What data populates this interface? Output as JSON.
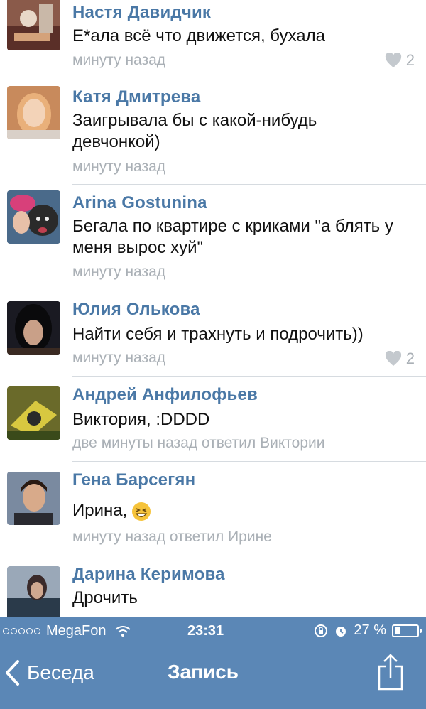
{
  "comments": [
    {
      "author": "Настя Давидчик",
      "text": "Е*ала всё что движется, бухала",
      "meta": "минуту назад",
      "likes": "2"
    },
    {
      "author": "Катя Дмитрева",
      "text": "Заигрывала бы с какой-нибудь девчонкой)",
      "meta": "минуту назад"
    },
    {
      "author": "Arina Gostunina",
      "text": "Бегала по квартире с криками \"а блять у меня вырос хуй\"",
      "meta": "минуту назад"
    },
    {
      "author": "Юлия Олькова",
      "text": "Найти себя и трахнуть и подрочить))",
      "meta": "минуту назад",
      "likes": "2"
    },
    {
      "author": "Андрей Анфилофьев",
      "text": "Виктория, :DDDD",
      "meta": "две минуты назад ответил Виктории"
    },
    {
      "author": "Гена Барсегян",
      "text": "Ирина,",
      "meta": "минуту назад ответил Ирине"
    },
    {
      "author": "Дарина Керимова",
      "text": "Дрочить"
    }
  ],
  "status_bar": {
    "carrier": "MegaFon",
    "time": "23:31",
    "battery": "27 %",
    "battery_level": 0.27
  },
  "nav": {
    "back_label": "Беседа",
    "title": "Запись"
  },
  "colors": {
    "accent": "#5b87b6",
    "name": "#4a78a6",
    "meta": "#aab0b6"
  }
}
